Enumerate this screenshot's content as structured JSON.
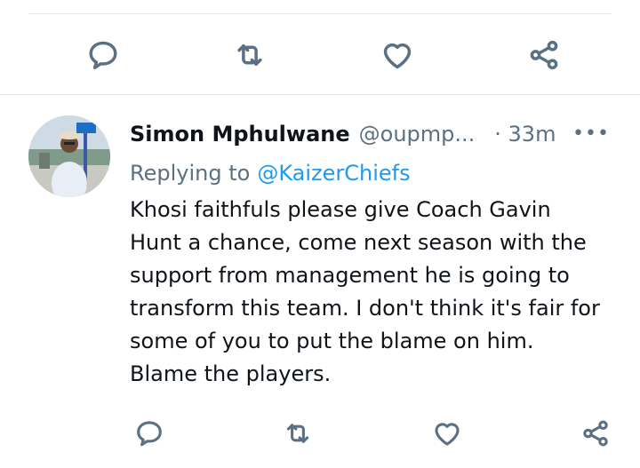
{
  "previous_tweet_actions": {
    "reply_icon": "reply-icon",
    "retweet_icon": "retweet-icon",
    "like_icon": "heart-icon",
    "share_icon": "share-icon"
  },
  "tweet": {
    "author": {
      "display_name": "Simon Mphulwane",
      "handle": "@oupmp...",
      "avatar_icon": "avatar"
    },
    "timestamp": "· 33m",
    "more_icon": "more-horizontal-icon",
    "more_label": "•••",
    "replying_prefix": "Replying to",
    "replying_to": "@KaizerChiefs",
    "text": "Khosi faithfuls please give Coach Gavin\nHunt a chance, come next season with the\nsupport from management he is going to\ntransform this team. I don't think it's fair for\nsome of you to put the blame on him.\nBlame the players.",
    "actions": {
      "reply_icon": "reply-icon",
      "retweet_icon": "retweet-icon",
      "like_icon": "heart-icon",
      "share_icon": "share-icon"
    }
  },
  "colors": {
    "text_primary": "#0f1419",
    "text_secondary": "#5b7083",
    "link": "#1d9bf0",
    "divider": "#e7e7e7"
  }
}
